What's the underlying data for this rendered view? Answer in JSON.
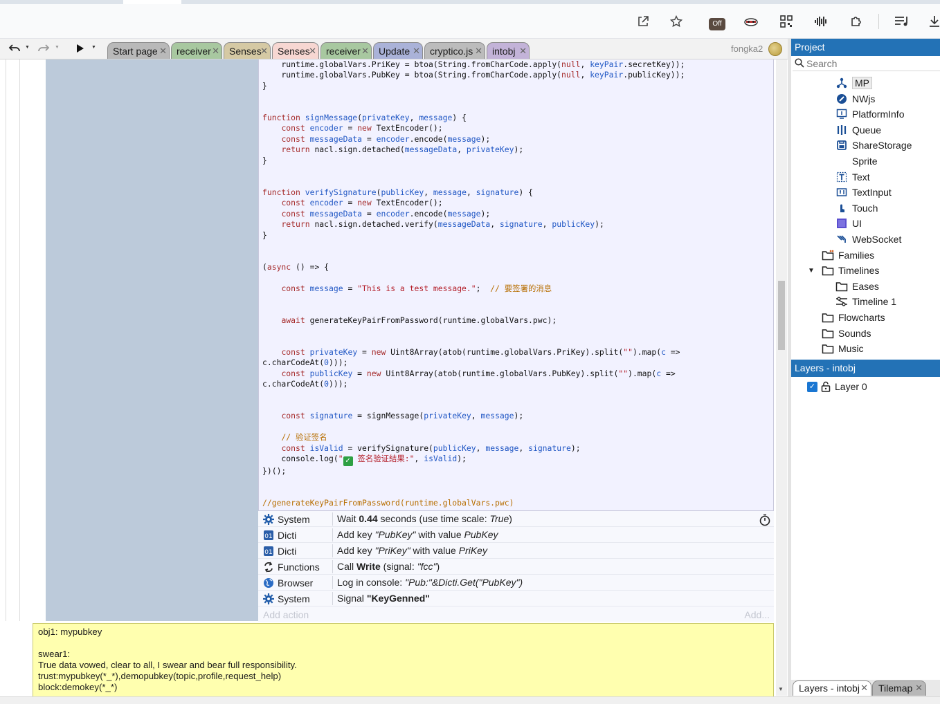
{
  "browser": {
    "icons": [
      "open-in-new-icon",
      "star-icon",
      "off-extension-icon",
      "mask-extension-icon",
      "qr-code-icon",
      "audio-wave-icon",
      "puzzle-icon",
      "playlist-icon",
      "download-icon"
    ],
    "off_badge": "Off"
  },
  "toolbar": {
    "tabs": [
      {
        "label": "Start page",
        "color": "#b9b9b9"
      },
      {
        "label": "receiver",
        "color": "#a8c8a0"
      },
      {
        "label": "Senses",
        "color": "#d5c9a4"
      },
      {
        "label": "Senses",
        "color": "#f7d7d2"
      },
      {
        "label": "receiver",
        "color": "#a8c8a0"
      },
      {
        "label": "Update",
        "color": "#aab2d8"
      },
      {
        "label": "cryptico.js",
        "color": "#bcbcbc"
      },
      {
        "label": "intobj",
        "color": "#c3b3d8"
      }
    ],
    "close_glyph": "✕",
    "user": "fongka2"
  },
  "code": {
    "comment_line": "//generateKeyPairFromPassword(runtime.globalVars.pwc)"
  },
  "actions": [
    {
      "object": "System",
      "icon": "gear-icon",
      "parts": [
        [
          "Wait ",
          ""
        ],
        [
          "0.44",
          "b"
        ],
        [
          " seconds (use time scale: ",
          ""
        ],
        [
          "True",
          "i"
        ],
        [
          ")",
          ""
        ]
      ]
    },
    {
      "object": "Dicti",
      "icon": "dictionary-icon",
      "parts": [
        [
          "Add key ",
          ""
        ],
        [
          "\"PubKey\"",
          "i"
        ],
        [
          " with value ",
          ""
        ],
        [
          "PubKey",
          "i"
        ]
      ]
    },
    {
      "object": "Dicti",
      "icon": "dictionary-icon",
      "parts": [
        [
          "Add key ",
          ""
        ],
        [
          "\"PriKey\"",
          "i"
        ],
        [
          " with value ",
          ""
        ],
        [
          "PriKey",
          "i"
        ]
      ]
    },
    {
      "object": "Functions",
      "icon": "functions-icon",
      "parts": [
        [
          "Call ",
          ""
        ],
        [
          "Write",
          "b"
        ],
        [
          " (signal: ",
          ""
        ],
        [
          "\"fcc\"",
          "i"
        ],
        [
          ")",
          ""
        ]
      ]
    },
    {
      "object": "Browser",
      "icon": "globe-icon",
      "parts": [
        [
          "Log in console: ",
          ""
        ],
        [
          "\"Pub:\"&Dicti.Get(\"PubKey\")",
          "i"
        ]
      ]
    },
    {
      "object": "System",
      "icon": "gear-icon",
      "parts": [
        [
          "Signal ",
          ""
        ],
        [
          "\"KeyGenned\"",
          "b"
        ]
      ]
    }
  ],
  "add_action": "Add action",
  "add_right": "Add...",
  "comment": "obj1: mypubkey\n\nswear1:\nTrue data vowed, clear to all, I swear and bear full responsibility.\ntrust:mypubkey(*_*),demopubkey(topic,profile,request_help)\nblock:demokey(*_*)",
  "project": {
    "title": "Project",
    "search_placeholder": "Search",
    "items": [
      {
        "label": "MP",
        "icon": "multiplayer-icon",
        "indent": 2,
        "selected": true
      },
      {
        "label": "NWjs",
        "icon": "nwjs-icon",
        "indent": 2
      },
      {
        "label": "PlatformInfo",
        "icon": "platform-info-icon",
        "indent": 2
      },
      {
        "label": "Queue",
        "icon": "queue-icon",
        "indent": 2
      },
      {
        "label": "ShareStorage",
        "icon": "storage-icon",
        "indent": 2
      },
      {
        "label": "Sprite",
        "icon": "",
        "indent": 2
      },
      {
        "label": "Text",
        "icon": "text-icon",
        "indent": 2
      },
      {
        "label": "TextInput",
        "icon": "text-input-icon",
        "indent": 2
      },
      {
        "label": "Touch",
        "icon": "touch-icon",
        "indent": 2
      },
      {
        "label": "UI",
        "icon": "ui-icon",
        "indent": 2
      },
      {
        "label": "WebSocket",
        "icon": "websocket-icon",
        "indent": 2
      },
      {
        "label": "Families",
        "icon": "families-folder-icon",
        "indent": 1
      },
      {
        "label": "Timelines",
        "icon": "folder-icon",
        "indent": 1,
        "expanded": true
      },
      {
        "label": "Eases",
        "icon": "folder-icon",
        "indent": 2
      },
      {
        "label": "Timeline 1",
        "icon": "timeline-icon",
        "indent": 2
      },
      {
        "label": "Flowcharts",
        "icon": "folder-icon",
        "indent": 1
      },
      {
        "label": "Sounds",
        "icon": "folder-icon",
        "indent": 1
      },
      {
        "label": "Music",
        "icon": "folder-icon",
        "indent": 1
      }
    ]
  },
  "layers": {
    "title": "Layers - intobj",
    "items": [
      {
        "label": "Layer 0",
        "visible": true
      }
    ]
  },
  "bottom_tabs": [
    {
      "label": "Layers - intobj",
      "active": true
    },
    {
      "label": "Tilemap",
      "active": false
    }
  ]
}
